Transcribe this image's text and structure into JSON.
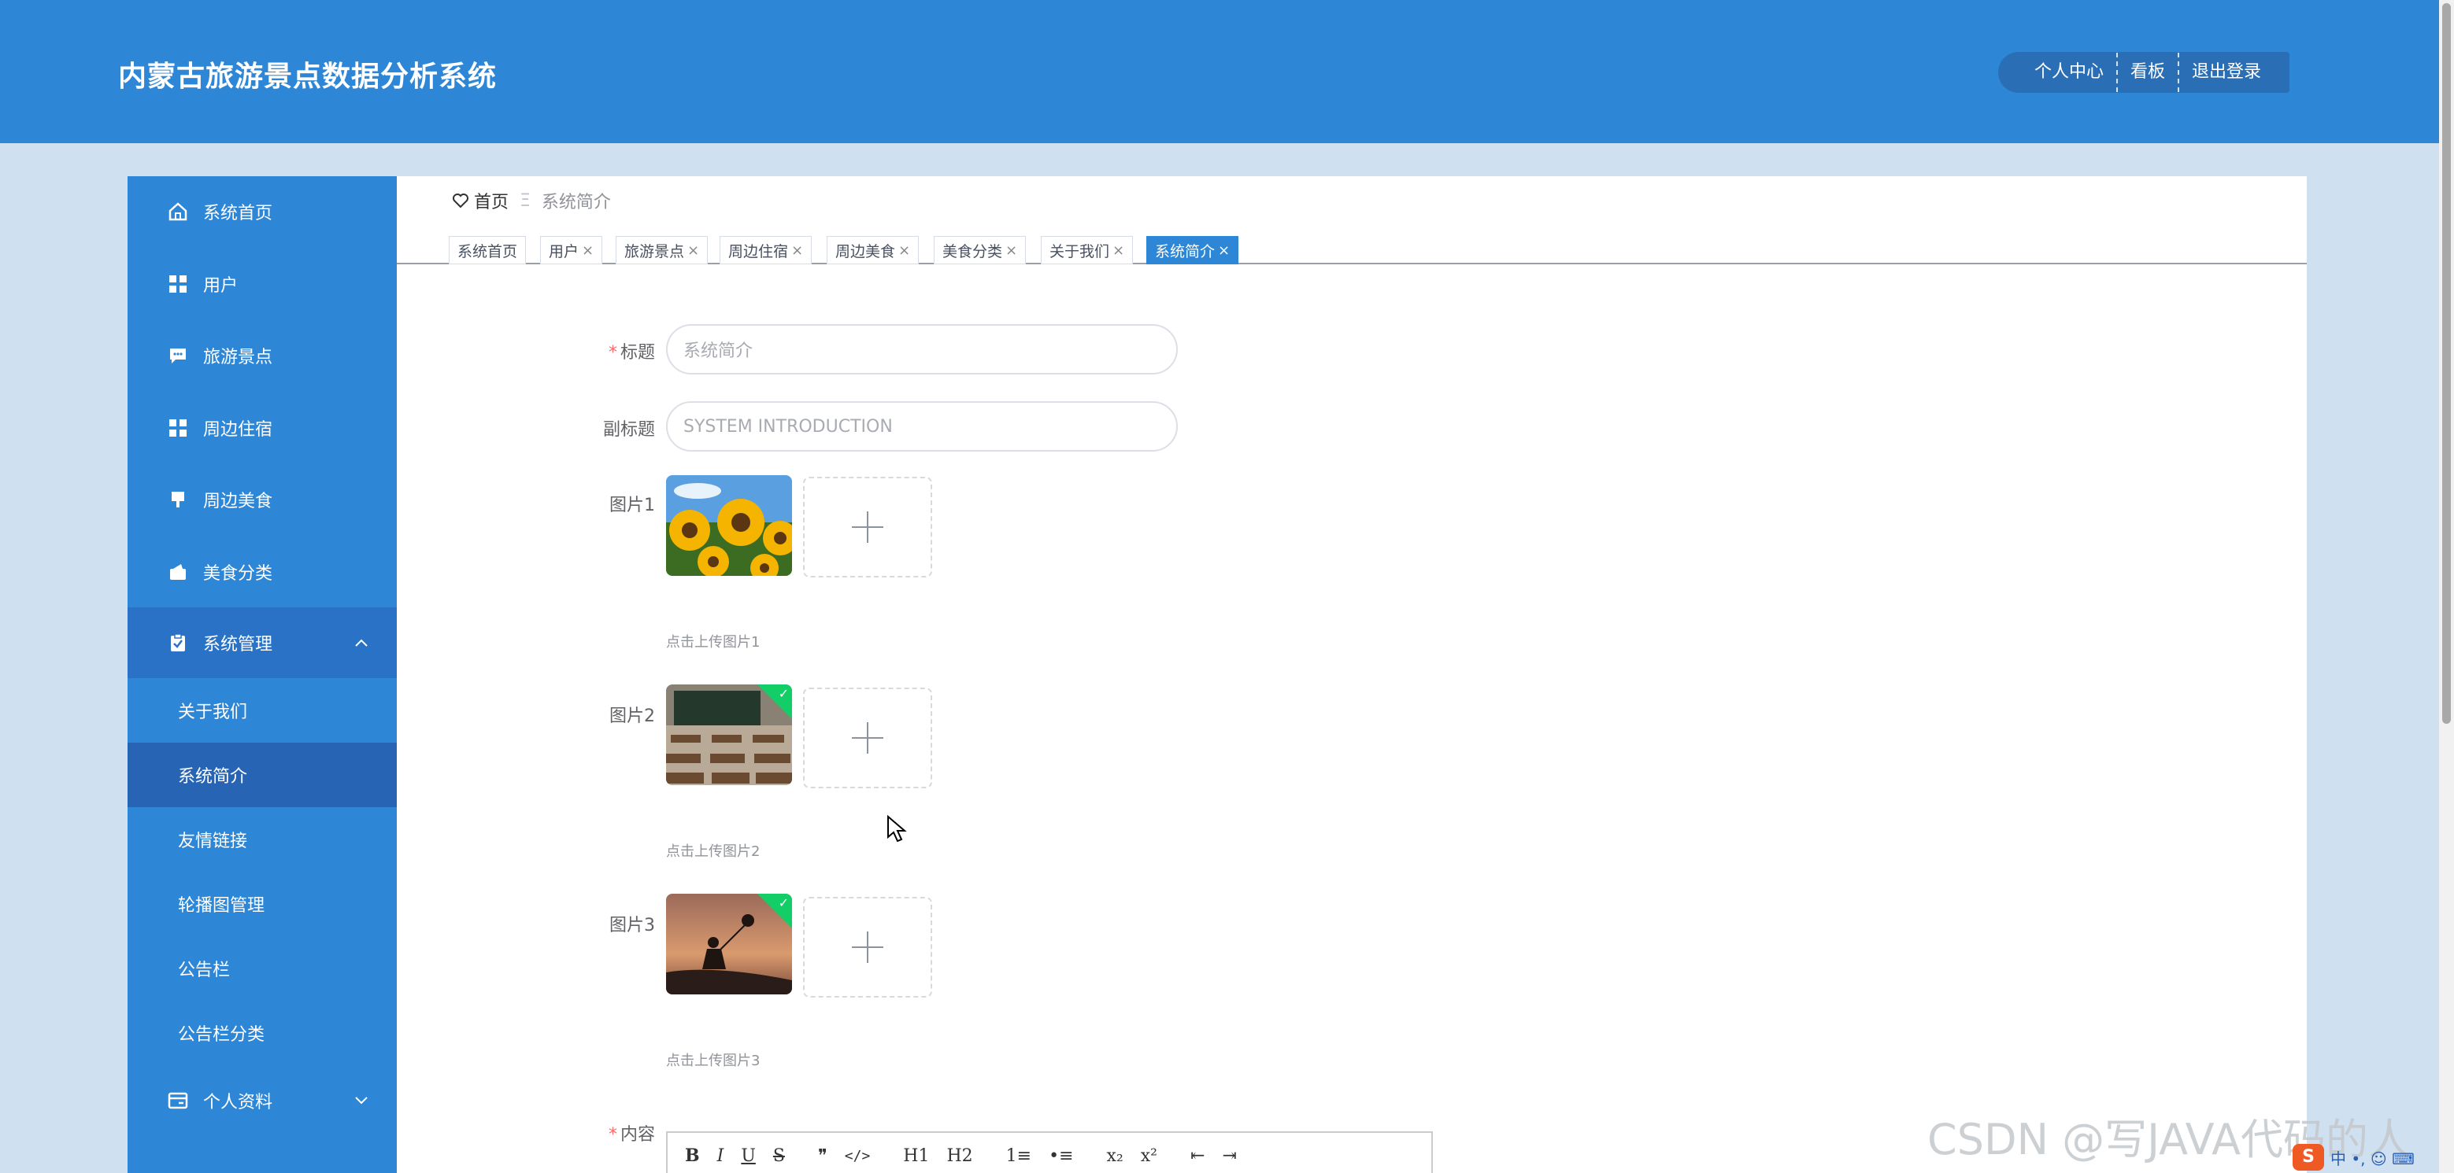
{
  "app": {
    "title": "内蒙古旅游景点数据分析系统"
  },
  "header_nav": [
    {
      "label": "个人中心"
    },
    {
      "label": "看板"
    },
    {
      "label": "退出登录"
    }
  ],
  "sidebar": {
    "items": [
      {
        "label": "系统首页",
        "icon": "home-icon"
      },
      {
        "label": "用户",
        "icon": "grid-icon"
      },
      {
        "label": "旅游景点",
        "icon": "chat-icon"
      },
      {
        "label": "周边住宿",
        "icon": "grid-icon"
      },
      {
        "label": "周边美食",
        "icon": "brush-icon"
      },
      {
        "label": "美食分类",
        "icon": "wallet-icon"
      },
      {
        "label": "系统管理",
        "icon": "clipboard-icon"
      }
    ],
    "sub_items": [
      {
        "label": "关于我们"
      },
      {
        "label": "系统简介"
      },
      {
        "label": "友情链接"
      },
      {
        "label": "轮播图管理"
      },
      {
        "label": "公告栏"
      },
      {
        "label": "公告栏分类"
      }
    ],
    "profile": {
      "label": "个人资料",
      "icon": "card-icon"
    }
  },
  "breadcrumb": {
    "home": "首页",
    "separator": "Ξ",
    "current": "系统简介"
  },
  "tabs": [
    {
      "label": "系统首页"
    },
    {
      "label": "用户"
    },
    {
      "label": "旅游景点"
    },
    {
      "label": "周边住宿"
    },
    {
      "label": "周边美食"
    },
    {
      "label": "美食分类"
    },
    {
      "label": "关于我们"
    },
    {
      "label": "系统简介"
    }
  ],
  "form": {
    "title_label": "标题",
    "title_value": "系统简介",
    "subtitle_label": "副标题",
    "subtitle_value": "SYSTEM INTRODUCTION",
    "image1_label": "图片1",
    "image1_tip": "点击上传图片1",
    "image2_label": "图片2",
    "image2_tip": "点击上传图片2",
    "image3_label": "图片3",
    "image3_tip": "点击上传图片3",
    "content_label": "内容",
    "required_mark": "*"
  },
  "editor_toolbar": [
    "B",
    "I",
    "U",
    "S",
    "❞",
    "</>",
    "H1",
    "H2",
    "1≡",
    "•≡",
    "x₂",
    "x²",
    "⇤",
    "⇥"
  ],
  "watermark": "CSDN @写JAVA代码的人",
  "ime": {
    "logo": "S",
    "text": "中 •, ☺ ⌨"
  },
  "colors": {
    "header": "#2e86d6",
    "sidebar": "#2e86d6",
    "active_sub": "#2764b4",
    "tab_active": "#2e86d6"
  }
}
